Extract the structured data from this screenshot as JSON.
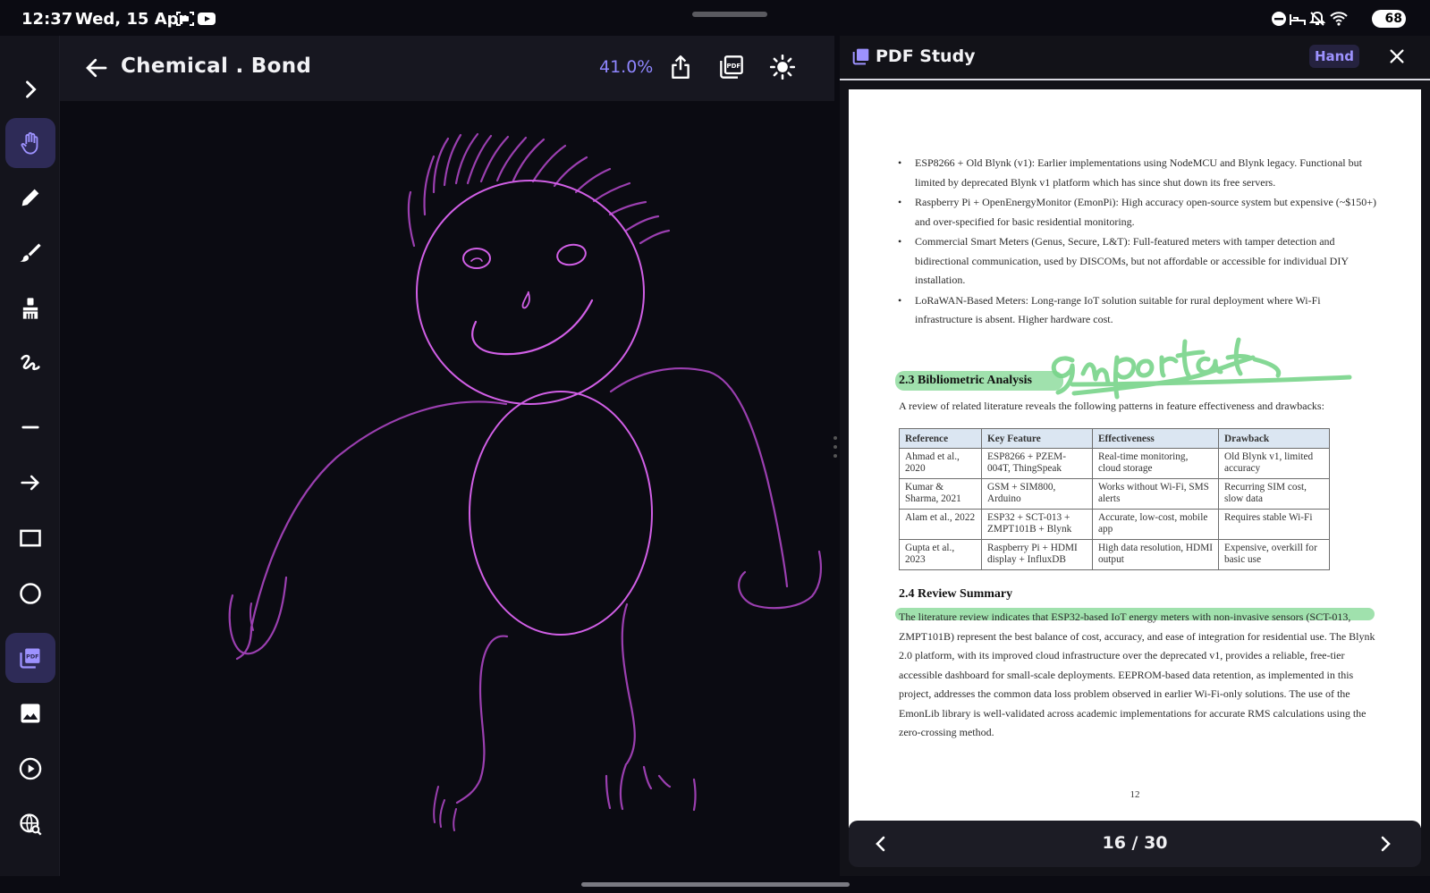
{
  "status_bar": {
    "time": "12:37",
    "date": "Wed, 15 Apr",
    "battery": "68"
  },
  "toolbar": {
    "title": "Chemical . Bond",
    "zoom": "41.0%"
  },
  "tools": [
    {
      "name": "expand",
      "icon": "chevron-right-icon"
    },
    {
      "name": "hand",
      "icon": "hand-icon",
      "active": true
    },
    {
      "name": "pen",
      "icon": "pencil-icon"
    },
    {
      "name": "brush",
      "icon": "brush-icon"
    },
    {
      "name": "eraser",
      "icon": "eraser-icon"
    },
    {
      "name": "scribble",
      "icon": "scribble-icon"
    },
    {
      "name": "line",
      "icon": "line-icon"
    },
    {
      "name": "arrow",
      "icon": "arrow-right-icon"
    },
    {
      "name": "rectangle",
      "icon": "rectangle-icon"
    },
    {
      "name": "circle",
      "icon": "circle-icon"
    },
    {
      "name": "pdf",
      "icon": "pdf-icon",
      "active": true
    },
    {
      "name": "image",
      "icon": "image-icon"
    },
    {
      "name": "play",
      "icon": "play-icon"
    },
    {
      "name": "web-search",
      "icon": "globe-search-icon"
    }
  ],
  "panel": {
    "title": "PDF Study",
    "mode_chip": "Hand",
    "page_counter": "16 / 30"
  },
  "pdf": {
    "bullets": [
      "ESP8266 + Old Blynk (v1): Earlier implementations using NodeMCU and Blynk legacy. Functional but limited by deprecated Blynk v1 platform which has since shut down its free servers.",
      "Raspberry Pi + OpenEnergyMonitor (EmonPi): High accuracy open-source system but expensive (~$150+) and over-specified for basic residential monitoring.",
      "Commercial Smart Meters (Genus, Secure, L&T): Full-featured meters with tamper detection and bidirectional communication, used by DISCOMs, but not affordable or accessible for individual DIY installation.",
      "LoRaWAN-Based Meters: Long-range IoT solution suitable for rural deployment where Wi-Fi infrastructure is absent. Higher hardware cost."
    ],
    "section_23_title": "2.3  Bibliometric Analysis",
    "section_23_intro": "A review of related literature reveals the following patterns in feature effectiveness and drawbacks:",
    "table": {
      "headers": [
        "Reference",
        "Key Feature",
        "Effectiveness",
        "Drawback"
      ],
      "rows": [
        [
          "Ahmad et al., 2020",
          "ESP8266 + PZEM-004T, ThingSpeak",
          "Real-time monitoring, cloud storage",
          "Old Blynk v1, limited accuracy"
        ],
        [
          "Kumar & Sharma, 2021",
          "GSM + SIM800, Arduino",
          "Works without Wi-Fi, SMS alerts",
          "Recurring SIM cost, slow data"
        ],
        [
          "Alam et al., 2022",
          "ESP32 + SCT-013 + ZMPT101B + Blynk",
          "Accurate, low-cost, mobile app",
          "Requires stable Wi-Fi"
        ],
        [
          "Gupta et al., 2023",
          "Raspberry Pi + HDMI display + InfluxDB",
          "High data resolution, HDMI output",
          "Expensive, overkill for basic use"
        ]
      ]
    },
    "section_24_title": "2.4  Review Summary",
    "section_24_body": "The literature review indicates that ESP32-based IoT energy meters with non-invasive sensors (SCT-013, ZMPT101B) represent the best balance of cost, accuracy, and ease of integration for residential use. The Blynk 2.0 platform, with its improved cloud infrastructure over the deprecated v1, provides a reliable, free-tier accessible dashboard for small-scale deployments. EEPROM-based data retention, as implemented in this project, addresses the common data loss problem observed in earlier Wi-Fi-only solutions. The use of the EmonLib library is well-validated across academic implementations for accurate RMS calculations using the zero-crossing method.",
    "page_number": "12",
    "handwritten_note": "important"
  },
  "colors": {
    "accent": "#8f86ff",
    "ink_stroke": "#9b3fb0",
    "head_stroke": "#d15fe6",
    "highlight": "#78d48a"
  }
}
